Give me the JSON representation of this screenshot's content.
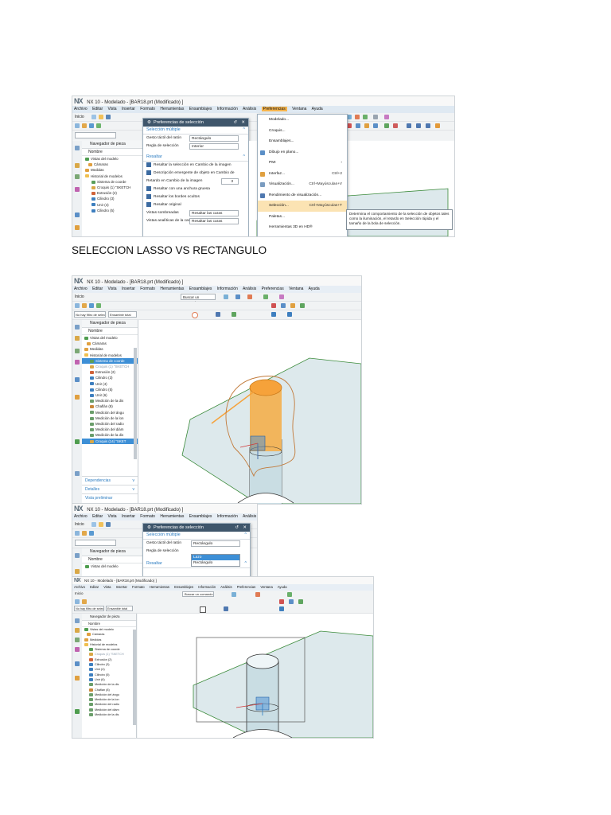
{
  "caption": "SELECCION LASSO VS RECTANGULO",
  "app": {
    "logo": "NX",
    "title_modified": "NX 10 - Modelado - [BAR18.prt (Modificado) ]",
    "title_plain": "NX 10 - Modelado - [BAR18.prt (Modificado) ]"
  },
  "menubar": [
    "Archivo",
    "Editar",
    "Vista",
    "Insertar",
    "Formato",
    "Herramientas",
    "Ensamblajes",
    "Información",
    "Análisis",
    "Preferencias",
    "Ventana",
    "Ayuda"
  ],
  "toolbar": {
    "start_label": "Inicio",
    "command_search_placeholder": "Buscar un comando",
    "filter_left": "No hay filtro de selección",
    "filter_right": "Ensamble total"
  },
  "navigator": {
    "title": "Navegador de pieza",
    "column": "Nombre",
    "items": [
      "Vistas del modelo",
      "Cámaras",
      "Medidas",
      "Historial de modelos",
      "Sistema de coorde",
      "Croquis (1) \"SKETCH",
      "Extrusión (2)",
      "Cilindro (3)",
      "Unir (4)",
      "Cilindro (5)",
      "Unir (6)",
      "Medición de la dis",
      "Chaflán (8)",
      "Medición del ángu",
      "Medición de la lon",
      "Medición del radio",
      "Medición del diám",
      "Medición de la dis",
      "Croquis (14) \"SKET"
    ],
    "bottom_tabs": [
      "Dependencias",
      "Detalles",
      "Vista preliminar"
    ]
  },
  "prefs_menu": {
    "items": [
      {
        "label": "Modelado...",
        "shortcut": ""
      },
      {
        "label": "Croquis...",
        "shortcut": ""
      },
      {
        "label": "Ensamblajes...",
        "shortcut": ""
      },
      {
        "label": "Dibujo en plano...",
        "shortcut": ""
      },
      {
        "label": "PMI",
        "shortcut": ""
      },
      {
        "label": "Interfaz...",
        "shortcut": "Ctrl+2"
      },
      {
        "label": "Visualización...",
        "shortcut": "Ctrl+Mayúsculas+V"
      },
      {
        "label": "Rendimiento de visualización...",
        "shortcut": ""
      },
      {
        "label": "Selección...",
        "shortcut": "Ctrl+Mayúsculas+T"
      },
      {
        "label": "Paletas...",
        "shortcut": ""
      },
      {
        "label": "Herramientas 3D en HD®",
        "shortcut": ""
      }
    ],
    "tooltip": "Determina el comportamiento de la selección de objetos tales como la iluminación, el retardo en Selección rápida y el tamaño de la bola de selección."
  },
  "selection_dialog": {
    "title": "Preferencias de selección",
    "section_multi": "Selección múltiple",
    "gesture_label": "Gesto táctil del ratón",
    "gesture_value": "Rectángulo",
    "rule_label": "Regla de selección",
    "rule_value": "Interior",
    "section_highlight": "Resaltar",
    "checks": [
      "Resaltar la selección en Cambio de la imagen",
      "Descripción emergente de objeto en Cambio de",
      "Resaltar con una anchura gruesa",
      "Resaltar los bordes ocultos",
      "Resaltar original"
    ],
    "delay_label": "Retardo en Cambio de la imagen",
    "delay_value": "3",
    "shaded_label": "Vistas sombreadas",
    "shaded_value": "Resaltar las caras",
    "analytic_label": "Vistas analíticas de la car",
    "analytic_value": "Resaltar las caras",
    "dropdown_options": [
      "Lazo",
      "Rectángulo"
    ]
  },
  "colors": {
    "menubar_bg": "#dfe9f2",
    "dialog_title_bg": "#3f566b",
    "accent_blue": "#2a7bc0",
    "highlight_orange": "#f6a23a",
    "surface_fill": "#dde9ec",
    "selection_blue": "#3d8fd6"
  }
}
